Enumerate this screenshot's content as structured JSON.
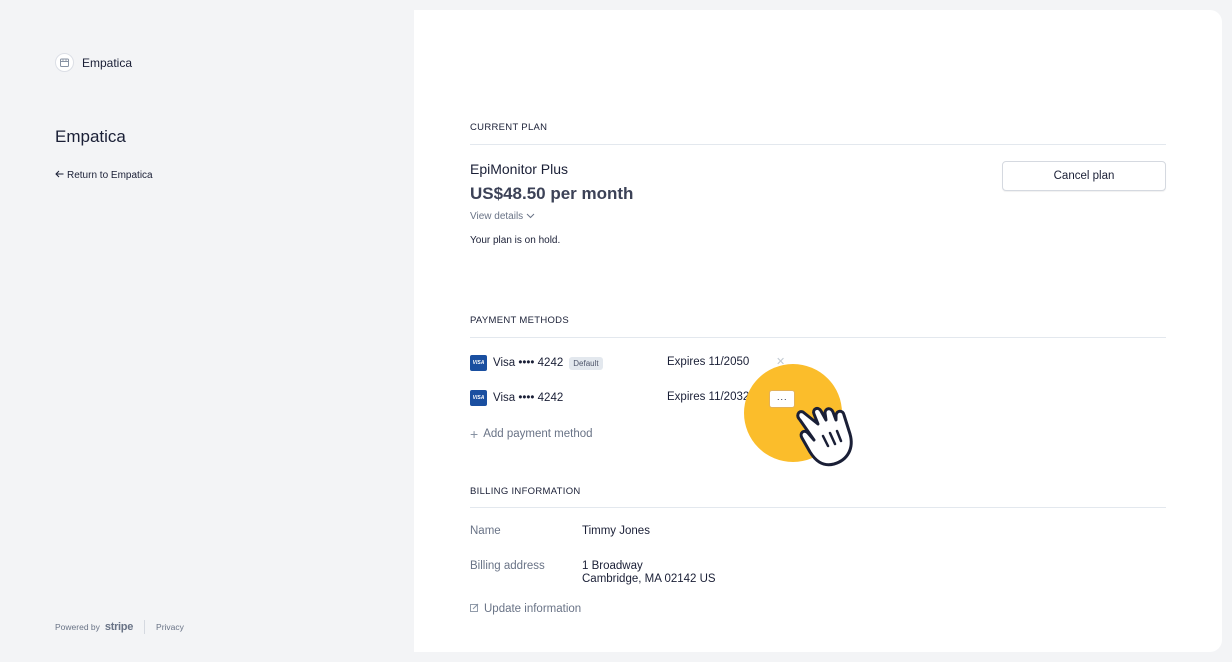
{
  "sidebar": {
    "brand_name": "Empatica",
    "merchant_title": "Empatica",
    "return_link": "Return to Empatica",
    "footer": {
      "powered_by": "Powered by",
      "stripe": "stripe",
      "privacy": "Privacy"
    }
  },
  "current_plan": {
    "section_title": "CURRENT PLAN",
    "plan_name": "EpiMonitor Plus",
    "price": "US$48.50 per month",
    "view_details": "View details",
    "status_text": "Your plan is on hold.",
    "cancel_button": "Cancel plan"
  },
  "payment_methods": {
    "section_title": "PAYMENT METHODS",
    "cards": [
      {
        "brand": "Visa",
        "brand_badge": "VISA",
        "masked": "Visa •••• 4242",
        "default_badge": "Default",
        "expires": "Expires 11/2050"
      },
      {
        "brand": "Visa",
        "brand_badge": "VISA",
        "masked": "Visa •••• 4242",
        "expires": "Expires 11/2032"
      }
    ],
    "more_button": "···",
    "add_label": "Add payment method"
  },
  "billing_information": {
    "section_title": "BILLING INFORMATION",
    "name_label": "Name",
    "name_value": "Timmy Jones",
    "address_label": "Billing address",
    "address_line1": "1 Broadway",
    "address_line2": "Cambridge, MA 02142 US",
    "update_label": "Update information"
  },
  "colors": {
    "highlight": "#fbbd2b",
    "visa_blue": "#1a4fa0",
    "muted_text": "#697386"
  }
}
